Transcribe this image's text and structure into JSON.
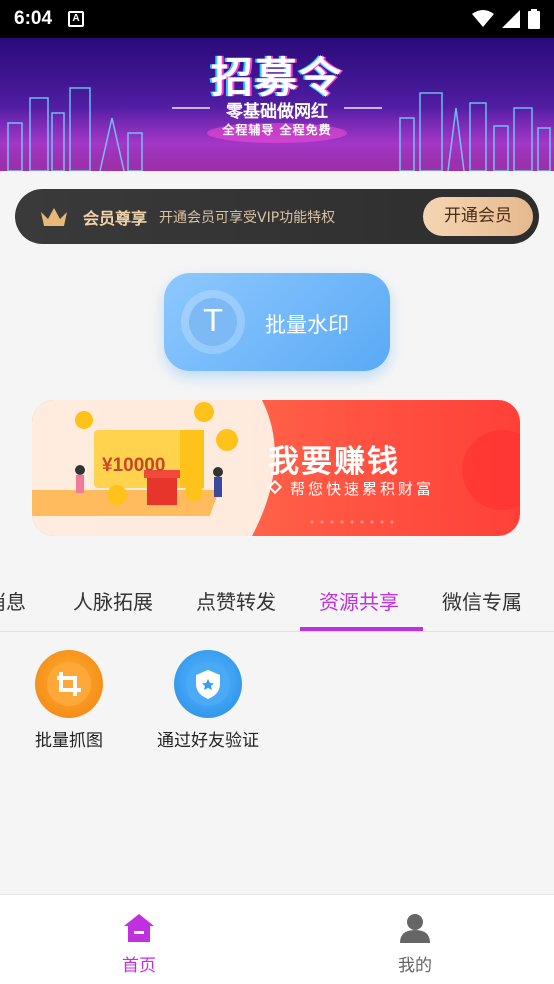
{
  "status_bar": {
    "time": "6:04",
    "notification": "A"
  },
  "banner": {
    "title": "招募令",
    "subtitle": "零基础做网红",
    "tagline": "全程辅导  全程免费"
  },
  "vip": {
    "title": "会员尊享",
    "description": "开通会员可享受VIP功能特权",
    "button_label": "开通会员",
    "icon": "crown-icon"
  },
  "watermark": {
    "label": "批量水印",
    "icon_glyph": "T"
  },
  "earn_banner": {
    "title": "我要赚钱",
    "subtitle": "帮您快速累积财富",
    "amount": "¥10000"
  },
  "tabs": [
    {
      "label": "消息",
      "active": false
    },
    {
      "label": "人脉拓展",
      "active": false
    },
    {
      "label": "点赞转发",
      "active": false
    },
    {
      "label": "资源共享",
      "active": true
    },
    {
      "label": "微信专属",
      "active": false
    }
  ],
  "tools": [
    {
      "label": "批量抓图",
      "icon": "crop-icon",
      "color": "#f7941d"
    },
    {
      "label": "通过好友验证",
      "icon": "shield-star-icon",
      "color": "#3a9ef0"
    }
  ],
  "bottom_nav": [
    {
      "label": "首页",
      "icon": "home-icon",
      "active": true,
      "color": "#c030e0"
    },
    {
      "label": "我的",
      "icon": "user-icon",
      "active": false,
      "color": "#666666"
    }
  ]
}
